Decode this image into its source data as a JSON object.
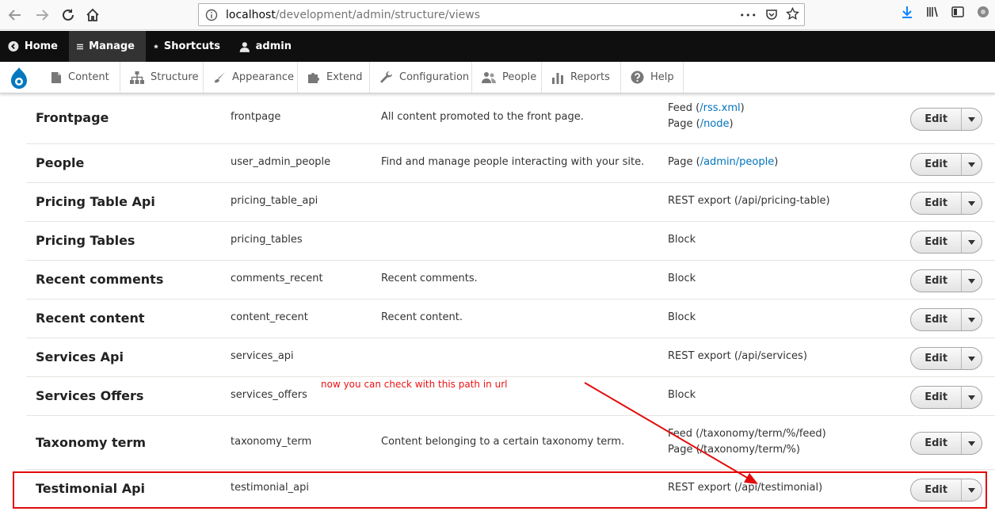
{
  "browser": {
    "url_host": "localhost",
    "url_path": "/development/admin/structure/views",
    "more_label": "•••"
  },
  "toolbar": {
    "home": "Home",
    "manage": "Manage",
    "shortcuts": "Shortcuts",
    "user": "admin"
  },
  "tray": {
    "items": [
      "Content",
      "Structure",
      "Appearance",
      "Extend",
      "Configuration",
      "People",
      "Reports",
      "Help"
    ]
  },
  "views": {
    "edit_label": "Edit",
    "rows": [
      {
        "name": "Frontpage",
        "machine": "frontpage",
        "desc": "All content promoted to the front page.",
        "display1_pre": "Feed (",
        "display1_link": "/rss.xml",
        "display1_post": ")",
        "display2_pre": "Page (",
        "display2_link": "/node",
        "display2_post": ")"
      },
      {
        "name": "People",
        "machine": "user_admin_people",
        "desc": "Find and manage people interacting with your site.",
        "display1_pre": "Page (",
        "display1_link": "/admin/people",
        "display1_post": ")"
      },
      {
        "name": "Pricing Table Api",
        "machine": "pricing_table_api",
        "desc": "",
        "display1": "REST export (/api/pricing-table)"
      },
      {
        "name": "Pricing Tables",
        "machine": "pricing_tables",
        "desc": "",
        "display1": "Block"
      },
      {
        "name": "Recent comments",
        "machine": "comments_recent",
        "desc": "Recent comments.",
        "display1": "Block"
      },
      {
        "name": "Recent content",
        "machine": "content_recent",
        "desc": "Recent content.",
        "display1": "Block"
      },
      {
        "name": "Services Api",
        "machine": "services_api",
        "desc": "",
        "display1": "REST export (/api/services)"
      },
      {
        "name": "Services Offers",
        "machine": "services_offers",
        "desc": "",
        "display1": "Block"
      },
      {
        "name": "Taxonomy term",
        "machine": "taxonomy_term",
        "desc": "Content belonging to a certain taxonomy term.",
        "display1": "Feed (/taxonomy/term/%/feed)",
        "display2": "Page (/taxonomy/term/%)"
      },
      {
        "name": "Testimonial Api",
        "machine": "testimonial_api",
        "desc": "",
        "display1": "REST export (/api/testimonial)"
      }
    ]
  },
  "annotation": {
    "note": "now you can check with this path in url",
    "color": "#e30a0a"
  }
}
